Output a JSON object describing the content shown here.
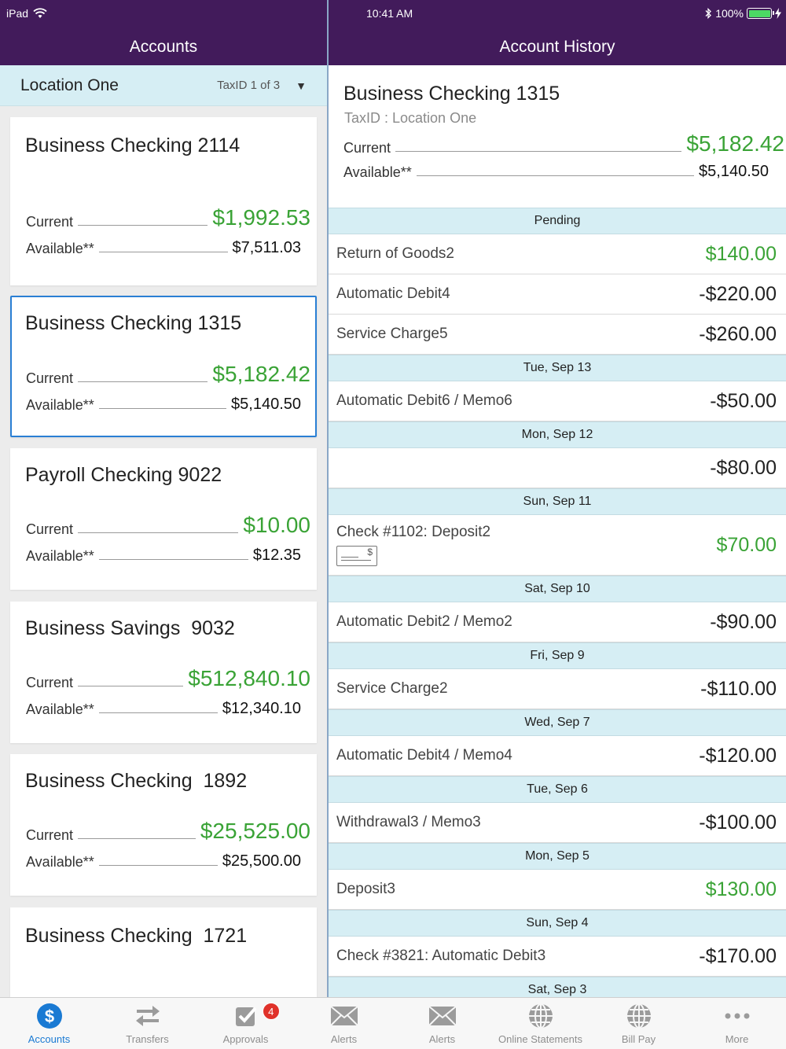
{
  "status_bar": {
    "device": "iPad",
    "time": "10:41 AM",
    "battery": "100%"
  },
  "left_header": {
    "title": "Accounts"
  },
  "right_header": {
    "title": "Account History"
  },
  "location": {
    "name": "Location One",
    "taxid": "TaxID 1 of 3"
  },
  "accounts": [
    {
      "name": "Business Checking 2114",
      "current_label": "Current",
      "current": "$1,992.53",
      "available_label": "Available**",
      "available": "$7,511.03"
    },
    {
      "name": "Business Checking 1315",
      "current_label": "Current",
      "current": "$5,182.42",
      "available_label": "Available**",
      "available": "$5,140.50"
    },
    {
      "name": "Payroll Checking 9022",
      "current_label": "Current",
      "current": "$10.00",
      "available_label": "Available**",
      "available": "$12.35"
    },
    {
      "name": "Business Savings  9032",
      "current_label": "Current",
      "current": "$512,840.10",
      "available_label": "Available**",
      "available": "$12,340.10"
    },
    {
      "name": "Business Checking  1892",
      "current_label": "Current",
      "current": "$25,525.00",
      "available_label": "Available**",
      "available": "$25,500.00"
    },
    {
      "name": "Business Checking  1721"
    }
  ],
  "history": {
    "title": "Business Checking 1315",
    "subtitle": "TaxID : Location One",
    "current_label": "Current",
    "current": "$5,182.42",
    "available_label": "Available**",
    "available": "$5,140.50",
    "sections": [
      {
        "label": "Pending",
        "items": [
          {
            "desc": "Return of Goods2",
            "amount": "$140.00",
            "positive": true
          },
          {
            "desc": "Automatic Debit4",
            "amount": "-$220.00",
            "positive": false
          },
          {
            "desc": "Service Charge5",
            "amount": "-$260.00",
            "positive": false
          }
        ]
      },
      {
        "label": "Tue, Sep 13",
        "items": [
          {
            "desc": "Automatic Debit6 / Memo6",
            "amount": "-$50.00",
            "positive": false
          }
        ]
      },
      {
        "label": "Mon, Sep 12",
        "items": [
          {
            "desc": "",
            "amount": "-$80.00",
            "positive": false
          }
        ]
      },
      {
        "label": "Sun, Sep 11",
        "items": [
          {
            "desc": "Check #1102: Deposit2",
            "amount": "$70.00",
            "positive": true,
            "check": true
          }
        ]
      },
      {
        "label": "Sat, Sep 10",
        "items": [
          {
            "desc": "Automatic Debit2 / Memo2",
            "amount": "-$90.00",
            "positive": false
          }
        ]
      },
      {
        "label": "Fri, Sep 9",
        "items": [
          {
            "desc": "Service Charge2",
            "amount": "-$110.00",
            "positive": false
          }
        ]
      },
      {
        "label": "Wed, Sep 7",
        "items": [
          {
            "desc": "Automatic Debit4 / Memo4",
            "amount": "-$120.00",
            "positive": false
          }
        ]
      },
      {
        "label": "Tue, Sep 6",
        "items": [
          {
            "desc": "Withdrawal3 / Memo3",
            "amount": "-$100.00",
            "positive": false
          }
        ]
      },
      {
        "label": "Mon, Sep 5",
        "items": [
          {
            "desc": "Deposit3",
            "amount": "$130.00",
            "positive": true
          }
        ]
      },
      {
        "label": "Sun, Sep 4",
        "items": [
          {
            "desc": "Check #3821: Automatic Debit3",
            "amount": "-$170.00",
            "positive": false
          }
        ]
      },
      {
        "label": "Sat, Sep 3",
        "items": []
      }
    ]
  },
  "tabs": [
    {
      "label": "Accounts",
      "icon": "dollar-circle-icon",
      "active": true
    },
    {
      "label": "Transfers",
      "icon": "transfer-arrows-icon"
    },
    {
      "label": "Approvals",
      "icon": "approval-check-icon",
      "badge": "4"
    },
    {
      "label": "Alerts",
      "icon": "envelope-icon"
    },
    {
      "label": "Alerts",
      "icon": "envelope-icon"
    },
    {
      "label": "Online Statements",
      "icon": "globe-icon"
    },
    {
      "label": "Bill Pay",
      "icon": "globe-icon"
    },
    {
      "label": "More",
      "icon": "more-dots-icon"
    }
  ],
  "colors": {
    "header": "#421b5b",
    "accent": "#1a7ad3",
    "positive": "#3aa336",
    "section_bg": "#d6eef4",
    "selected_border": "#2a7fd4",
    "badge": "#e0322a"
  }
}
